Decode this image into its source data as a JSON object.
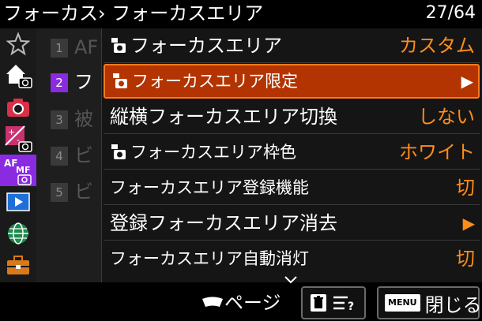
{
  "header": {
    "breadcrumb": "フォーカス› フォーカスエリア",
    "page_count": "27/64"
  },
  "sidebar": {
    "tabs": [
      {
        "name": "favorites-tab",
        "icon": "star-icon"
      },
      {
        "name": "main-shooting-tab",
        "icon": "home-camera-icon"
      },
      {
        "name": "camera-tab",
        "icon": "camera-icon"
      },
      {
        "name": "exposure-tab",
        "icon": "exposure-camera-icon"
      },
      {
        "name": "af-mf-tab",
        "icon": "af-mf-icon",
        "text_af": "AF",
        "text_mf": "MF"
      },
      {
        "name": "playback-tab",
        "icon": "play-icon"
      },
      {
        "name": "network-tab",
        "icon": "globe-icon"
      },
      {
        "name": "setup-tab",
        "icon": "toolbox-icon"
      }
    ],
    "active_tab_color": "#8a2be2"
  },
  "submenu": {
    "items": [
      {
        "num": "1",
        "label": "AF"
      },
      {
        "num": "2",
        "label": "フ"
      },
      {
        "num": "3",
        "label": "被"
      },
      {
        "num": "4",
        "label": "ビ"
      },
      {
        "num": "5",
        "label": "ビ"
      }
    ]
  },
  "menu": {
    "rows": [
      {
        "label": "フォーカスエリア",
        "value": "カスタム",
        "has_cam_icon": true
      },
      {
        "label": "フォーカスエリア限定",
        "value": "▶",
        "has_cam_icon": true
      },
      {
        "label": "縦横フォーカスエリア切換",
        "value": "しない",
        "has_cam_icon": false
      },
      {
        "label": "フォーカスエリア枠色",
        "value": "ホワイト",
        "has_cam_icon": true
      },
      {
        "label": "フォーカスエリア登録機能",
        "value": "切",
        "has_cam_icon": false
      },
      {
        "label": "登録フォーカスエリア消去",
        "value": "▶",
        "has_cam_icon": false
      },
      {
        "label": "フォーカスエリア自動消灯",
        "value": "切",
        "has_cam_icon": false
      }
    ],
    "selected_color": "#b33400",
    "value_color": "#ff8c1a"
  },
  "footer": {
    "page_label": "ページ",
    "menu_badge": "MENU",
    "close_label": "閉じる",
    "delete_icon": "trash-icon",
    "help_icon": "help-list-icon"
  }
}
